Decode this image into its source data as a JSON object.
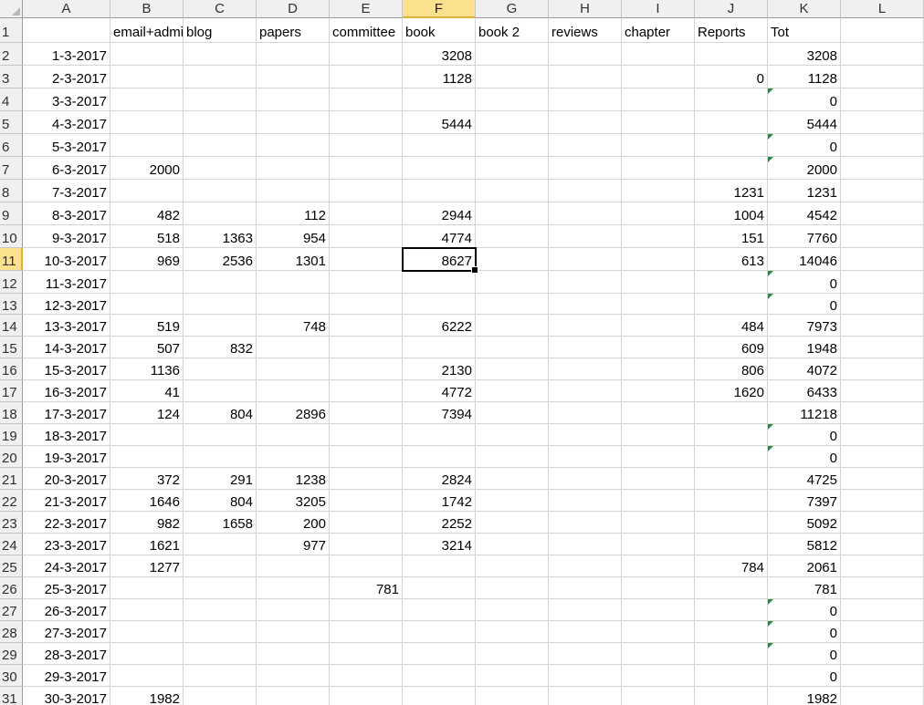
{
  "sheet": {
    "columns": [
      "A",
      "B",
      "C",
      "D",
      "E",
      "F",
      "G",
      "H",
      "I",
      "J",
      "K",
      "L"
    ],
    "selected_column": "F",
    "selected_row": 11,
    "headers": {
      "B": "email+admin",
      "C": "blog",
      "D": "papers",
      "E": "committee",
      "F": "book",
      "G": "book 2",
      "H": "reviews",
      "I": "chapter",
      "J": "Reports",
      "K": "Tot"
    },
    "rows": [
      {
        "row": 2,
        "A": "1-3-2017",
        "F": "3208",
        "K": "3208"
      },
      {
        "row": 3,
        "A": "2-3-2017",
        "F": "1128",
        "J": "0",
        "K": "1128"
      },
      {
        "row": 4,
        "A": "3-3-2017",
        "K": "0",
        "K_flag": true
      },
      {
        "row": 5,
        "A": "4-3-2017",
        "F": "5444",
        "K": "5444"
      },
      {
        "row": 6,
        "A": "5-3-2017",
        "K": "0",
        "K_flag": true
      },
      {
        "row": 7,
        "A": "6-3-2017",
        "B": "2000",
        "K": "2000",
        "K_flag": true
      },
      {
        "row": 8,
        "A": "7-3-2017",
        "J": "1231",
        "K": "1231"
      },
      {
        "row": 9,
        "A": "8-3-2017",
        "B": "482",
        "D": "112",
        "F": "2944",
        "J": "1004",
        "K": "4542"
      },
      {
        "row": 10,
        "A": "9-3-2017",
        "B": "518",
        "C": "1363",
        "D": "954",
        "F": "4774",
        "J": "151",
        "K": "7760"
      },
      {
        "row": 11,
        "A": "10-3-2017",
        "B": "969",
        "C": "2536",
        "D": "1301",
        "F": "8627",
        "J": "613",
        "K": "14046"
      },
      {
        "row": 12,
        "A": "11-3-2017",
        "K": "0",
        "K_flag": true
      },
      {
        "row": 13,
        "A": "12-3-2017",
        "K": "0",
        "K_flag": true
      },
      {
        "row": 14,
        "A": "13-3-2017",
        "B": "519",
        "D": "748",
        "F": "6222",
        "J": "484",
        "K": "7973"
      },
      {
        "row": 15,
        "A": "14-3-2017",
        "B": "507",
        "C": "832",
        "J": "609",
        "K": "1948"
      },
      {
        "row": 16,
        "A": "15-3-2017",
        "B": "1136",
        "F": "2130",
        "J": "806",
        "K": "4072"
      },
      {
        "row": 17,
        "A": "16-3-2017",
        "B": "41",
        "F": "4772",
        "J": "1620",
        "K": "6433"
      },
      {
        "row": 18,
        "A": "17-3-2017",
        "B": "124",
        "C": "804",
        "D": "2896",
        "F": "7394",
        "K": "11218"
      },
      {
        "row": 19,
        "A": "18-3-2017",
        "K": "0",
        "K_flag": true
      },
      {
        "row": 20,
        "A": "19-3-2017",
        "K": "0",
        "K_flag": true
      },
      {
        "row": 21,
        "A": "20-3-2017",
        "B": "372",
        "C": "291",
        "D": "1238",
        "F": "2824",
        "K": "4725"
      },
      {
        "row": 22,
        "A": "21-3-2017",
        "B": "1646",
        "C": "804",
        "D": "3205",
        "F": "1742",
        "K": "7397"
      },
      {
        "row": 23,
        "A": "22-3-2017",
        "B": "982",
        "C": "1658",
        "D": "200",
        "F": "2252",
        "K": "5092"
      },
      {
        "row": 24,
        "A": "23-3-2017",
        "B": "1621",
        "D": "977",
        "F": "3214",
        "K": "5812"
      },
      {
        "row": 25,
        "A": "24-3-2017",
        "B": "1277",
        "J": "784",
        "K": "2061"
      },
      {
        "row": 26,
        "A": "25-3-2017",
        "E": "781",
        "K": "781"
      },
      {
        "row": 27,
        "A": "26-3-2017",
        "K": "0",
        "K_flag": true
      },
      {
        "row": 28,
        "A": "27-3-2017",
        "K": "0",
        "K_flag": true
      },
      {
        "row": 29,
        "A": "28-3-2017",
        "K": "0",
        "K_flag": true
      },
      {
        "row": 30,
        "A": "29-3-2017",
        "K": "0"
      },
      {
        "row": 31,
        "A": "30-3-2017",
        "B": "1982",
        "K": "1982"
      }
    ],
    "colors": {
      "selected_header": "#fbe08e",
      "error_indicator": "#1e8e3e",
      "gridline": "#d4d4d4"
    }
  }
}
